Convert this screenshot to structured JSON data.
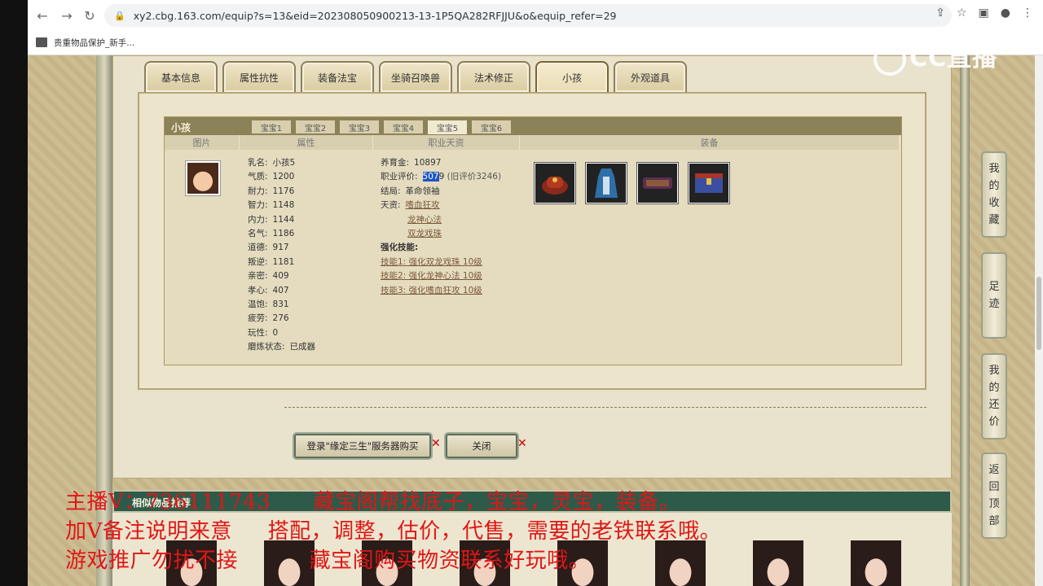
{
  "browser": {
    "url": "xy2.cbg.163.com/equip?s=13&eid=202308050900213-13-1P5QA282RFJJU&o&equip_refer=29",
    "bookmark_label": "贵重物品保护_新手..."
  },
  "tabs": [
    "基本信息",
    "属性抗性",
    "装备法宝",
    "坐骑召唤兽",
    "法术修正",
    "小孩",
    "外观道具"
  ],
  "panel": {
    "title": "小孩",
    "subtabs": [
      "宝宝1",
      "宝宝2",
      "宝宝3",
      "宝宝4",
      "宝宝5",
      "宝宝6"
    ],
    "headers": {
      "picture": "图片",
      "attributes": "属性",
      "career": "职业天资",
      "equipment": "装备"
    },
    "attributes": [
      {
        "k": "乳名:",
        "v": "小孩5"
      },
      {
        "k": "气质:",
        "v": "1200"
      },
      {
        "k": "耐力:",
        "v": "1176"
      },
      {
        "k": "智力:",
        "v": "1148"
      },
      {
        "k": "内力:",
        "v": "1144"
      },
      {
        "k": "名气:",
        "v": "1186"
      },
      {
        "k": "道德:",
        "v": "917"
      },
      {
        "k": "叛逆:",
        "v": "1181"
      },
      {
        "k": "亲密:",
        "v": "409"
      },
      {
        "k": "孝心:",
        "v": "407"
      },
      {
        "k": "温饱:",
        "v": "831"
      },
      {
        "k": "疲劳:",
        "v": "276"
      },
      {
        "k": "玩性:",
        "v": "0"
      },
      {
        "k": "磨炼状态:",
        "v": "已成器"
      }
    ],
    "career": {
      "raising_gold_label": "养育金:",
      "raising_gold": "10897",
      "rating_label": "职业评价:",
      "rating_sel": "507",
      "rating_rest": "9",
      "rating_old": "(旧评价3246)",
      "ending_label": "结局:",
      "ending": "革命领袖",
      "talent_label": "天资:",
      "talents": [
        "嗜血狂攻",
        "龙神心法",
        "双龙戏珠"
      ],
      "enhance_label": "强化技能:",
      "skills": [
        "技能1: 强化双龙戏珠 10级",
        "技能2: 强化龙神心法 10级",
        "技能3: 强化嗜血狂攻 10级"
      ]
    }
  },
  "buttons": {
    "login": "登录\"缘定三生\"服务器购买",
    "close": "关闭"
  },
  "similar_title": "相似物品推荐",
  "sidenav": [
    "我的收藏",
    "足迹",
    "我的还价",
    "返回顶部"
  ],
  "overlay": {
    "line1": "主播V：736111743      藏宝阁帮找底子，宝宝，灵宝，装备。",
    "line2": "加V备注说明来意     搭配，调整，估价，代售，需要的老铁联系哦。",
    "line3": "游戏推广勿扰不接          藏宝阁购买物资联系好玩哦。"
  },
  "logo_text": "CC直播",
  "colors": {
    "overlay_red": "#e11616",
    "tab_bar": "#8b8258",
    "similar_bar": "#2e5a4a"
  }
}
